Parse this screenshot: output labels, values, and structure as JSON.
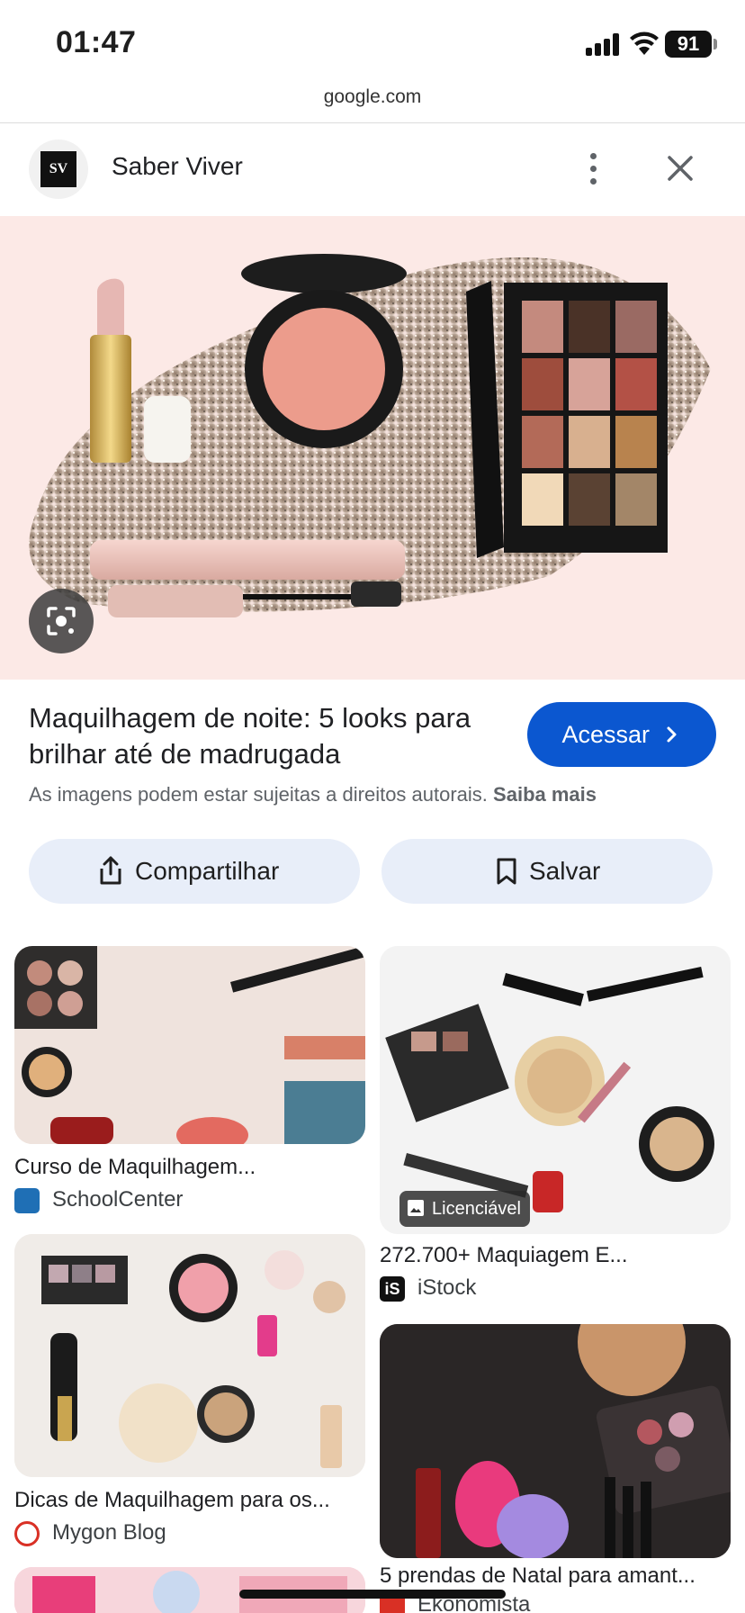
{
  "status_bar": {
    "time": "01:47",
    "battery": "91"
  },
  "browser": {
    "url": "google.com"
  },
  "viewer": {
    "site_name": "Saber Viver",
    "site_logo_text": "SV",
    "title": "Maquilhagem de noite: 5 looks para brilhar até de madrugada",
    "visit_label": "Acessar",
    "copyright_text": "As imagens podem estar sujeitas a direitos autorais.",
    "learn_more": "Saiba mais",
    "share_label": "Compartilhar",
    "save_label": "Salvar"
  },
  "related": [
    {
      "title": "Curso de Maquilhagem...",
      "source": "SchoolCenter"
    },
    {
      "title": "272.700+ Maquiagem E...",
      "source": "iStock",
      "badge": "Licenciável"
    },
    {
      "title": "Dicas de Maquilhagem para os...",
      "source": "Mygon Blog"
    },
    {
      "title": "5 prendas de Natal para amant...",
      "source": "Ekonomista"
    }
  ],
  "colors": {
    "accent": "#0b57d0",
    "action_bg": "#e8eef9",
    "hero_bg": "#fce9e6"
  },
  "icons": {
    "share": "share-icon",
    "save": "bookmark-icon",
    "more": "more-vert-icon",
    "close": "close-icon",
    "lens": "lens-icon",
    "chevron": "chevron-right-icon"
  }
}
